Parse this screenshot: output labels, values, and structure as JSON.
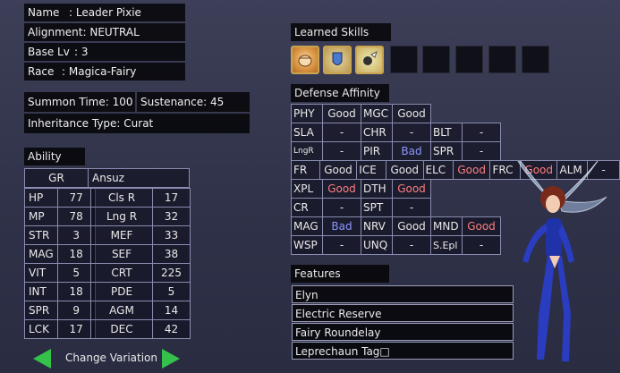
{
  "info": {
    "name_label": "Name",
    "name_value": ": Leader Pixie",
    "alignment": "Alignment: NEUTRAL",
    "base_lv_label": "Base Lv",
    "base_lv_value": ":  3",
    "race_label": "Race",
    "race_value": ": Magica-Fairy",
    "summon_time": "Summon Time: 100",
    "sustenance": "Sustenance: 45",
    "inheritance": "Inheritance Type: Curat"
  },
  "ability": {
    "title": "Ability",
    "tab_gr": "GR",
    "tab_ansuz": "Ansuz",
    "rows": [
      {
        "s1": "HP",
        "v1": "77",
        "s2": "Cls R",
        "v2": "17"
      },
      {
        "s1": "MP",
        "v1": "78",
        "s2": "Lng R",
        "v2": "32"
      },
      {
        "s1": "STR",
        "v1": "3",
        "s2": "MEF",
        "v2": "33"
      },
      {
        "s1": "MAG",
        "v1": "18",
        "s2": "SEF",
        "v2": "38"
      },
      {
        "s1": "VIT",
        "v1": "5",
        "s2": "CRT",
        "v2": "225"
      },
      {
        "s1": "INT",
        "v1": "18",
        "s2": "PDE",
        "v2": "5"
      },
      {
        "s1": "SPR",
        "v1": "9",
        "s2": "AGM",
        "v2": "14"
      },
      {
        "s1": "LCK",
        "v1": "17",
        "s2": "DEC",
        "v2": "42"
      }
    ]
  },
  "variation": {
    "label": "Change Variation"
  },
  "skills": {
    "title": "Learned Skills",
    "icons": [
      "fist-skill-icon",
      "shield-skill-icon",
      "fairy-skill-icon"
    ],
    "empty_slots": 5
  },
  "defense": {
    "title": "Defense Affinity",
    "rows": [
      [
        {
          "k": "PHY",
          "v": "Good",
          "c": "good"
        },
        {
          "k": "MGC",
          "v": "Good",
          "c": "good"
        }
      ],
      [
        {
          "k": "SLA",
          "v": "-",
          "c": "good"
        },
        {
          "k": "CHR",
          "v": "-",
          "c": "good"
        },
        {
          "k": "BLT",
          "v": "-",
          "c": "good"
        }
      ],
      [
        {
          "k": "LngR",
          "v": "-",
          "c": "good"
        },
        {
          "k": "PIR",
          "v": "Bad",
          "c": "bad"
        },
        {
          "k": "SPR",
          "v": "-",
          "c": "good"
        }
      ],
      [
        {
          "k": "FR",
          "v": "Good",
          "c": "good"
        },
        {
          "k": "ICE",
          "v": "Good",
          "c": "good"
        },
        {
          "k": "ELC",
          "v": "Good",
          "c": "weak"
        },
        {
          "k": "FRC",
          "v": "Good",
          "c": "weak"
        },
        {
          "k": "ALM",
          "v": "-",
          "c": "good"
        }
      ],
      [
        {
          "k": "XPL",
          "v": "Good",
          "c": "weak"
        },
        {
          "k": "DTH",
          "v": "Good",
          "c": "weak"
        }
      ],
      [
        {
          "k": "CR",
          "v": "-",
          "c": "good"
        },
        {
          "k": "SPT",
          "v": "-",
          "c": "good"
        }
      ],
      [
        {
          "k": "MAG",
          "v": "Bad",
          "c": "bad"
        },
        {
          "k": "NRV",
          "v": "Good",
          "c": "good"
        },
        {
          "k": "MND",
          "v": "Good",
          "c": "weak"
        }
      ],
      [
        {
          "k": "WSP",
          "v": "-",
          "c": "good"
        },
        {
          "k": "UNQ",
          "v": "-",
          "c": "good"
        },
        {
          "k": "S.Epl",
          "v": "-",
          "c": "good"
        }
      ]
    ]
  },
  "features": {
    "title": "Features",
    "items": [
      "Elyn",
      "Electric Reserve",
      "Fairy Roundelay",
      "Leprechaun Tag□"
    ]
  },
  "colors": {
    "good": "#e6e6e6",
    "weak": "#ff7f7f",
    "bad": "#8c97ff",
    "arrow": "#35c24a"
  }
}
